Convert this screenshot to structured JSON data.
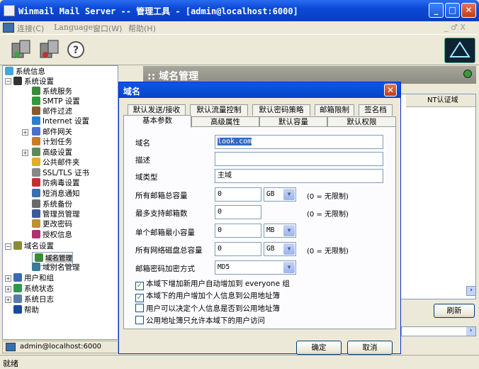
{
  "window": {
    "title": "Winmail Mail Server -- 管理工具 - [admin@localhost:6000]",
    "min": "_",
    "max": "□",
    "close": "✕"
  },
  "menubar": {
    "items": [
      {
        "label": "连接(C)"
      },
      {
        "label": "Language"
      },
      {
        "label": "窗口(W)"
      },
      {
        "label": "帮助(H)"
      }
    ],
    "right": "_ ♂ X"
  },
  "tree": {
    "nodes": [
      {
        "label": "系统信息",
        "color": "#4aa3df"
      },
      {
        "label": "系统设置",
        "color": "#333333"
      },
      {
        "label": "系统服务",
        "color": "#3a8a3a"
      },
      {
        "label": "SMTP 设置",
        "color": "#2e9b3c"
      },
      {
        "label": "邮件过滤",
        "color": "#8a5a2a"
      },
      {
        "label": "Internet 设置",
        "color": "#2a7fd0"
      },
      {
        "label": "邮件网关",
        "color": "#4a6fd0"
      },
      {
        "label": "计划任务",
        "color": "#c87c2a"
      },
      {
        "label": "高级设置",
        "color": "#5a8a5a"
      },
      {
        "label": "公共邮件夹",
        "color": "#e0b020"
      },
      {
        "label": "SSL/TLS 证书",
        "color": "#888888"
      },
      {
        "label": "防病毒设置",
        "color": "#c03030"
      },
      {
        "label": "短消息通知",
        "color": "#3a6fb0"
      },
      {
        "label": "系统备份",
        "color": "#6a6a6a"
      },
      {
        "label": "管理员管理",
        "color": "#3a5a9a"
      },
      {
        "label": "更改密码",
        "color": "#c09030"
      },
      {
        "label": "授权信息",
        "color": "#b03070"
      },
      {
        "label": "域名设置",
        "color": "#8a8a3a"
      },
      {
        "label": "域名管理",
        "color": "#3a8a3a"
      },
      {
        "label": "域别名管理",
        "color": "#3a7a9a"
      },
      {
        "label": "用户和组",
        "color": "#3a6ab0"
      },
      {
        "label": "系统状态",
        "color": "#2a9a4a"
      },
      {
        "label": "系统日志",
        "color": "#5a7aaa"
      },
      {
        "label": "帮助",
        "color": "#1a4a9a"
      }
    ]
  },
  "status_user": "admin@localhost:6000",
  "statusbar": "就绪",
  "rightpane": {
    "header": ":: 域名管理",
    "col_header": "NT认证域",
    "refresh": "刷新"
  },
  "dialog": {
    "title": "域名",
    "tabs_row1": [
      "默认发送/接收",
      "默认流量控制",
      "默认密码策略",
      "邮箱限制",
      "签名档"
    ],
    "tabs_row2": [
      "基本参数",
      "高级属性",
      "默认容量",
      "默认权限"
    ],
    "labels": {
      "domain": "域名",
      "desc": "描述",
      "type": "域类型",
      "total_mailbox_size": "所有邮箱总容量",
      "max_mailboxes": "最多支持邮箱数",
      "min_mailbox_size": "单个邮箱最小容量",
      "total_netdisk": "所有网络磁盘总容量",
      "pwd_encrypt": "邮箱密码加密方式"
    },
    "values": {
      "domain": "look.com",
      "desc": "",
      "type": "主域",
      "total_mailbox_size": "0",
      "total_mailbox_unit": "GB",
      "max_mailboxes": "0",
      "min_mailbox_size": "0",
      "min_mailbox_unit": "MB",
      "total_netdisk": "0",
      "total_netdisk_unit": "GB",
      "pwd_encrypt": "MD5"
    },
    "notes": {
      "unlimited": "(0 = 无限制)"
    },
    "checks": [
      {
        "label": "本域下增加新用户自动增加到 everyone 组",
        "checked": true
      },
      {
        "label": "本域下的用户增加个人信息到公用地址簿",
        "checked": true
      },
      {
        "label": "用户可以决定个人信息是否到公用地址簿",
        "checked": false
      },
      {
        "label": "公用地址簿只允许本域下的用户访问",
        "checked": false
      }
    ],
    "ok": "确定",
    "cancel": "取消"
  }
}
